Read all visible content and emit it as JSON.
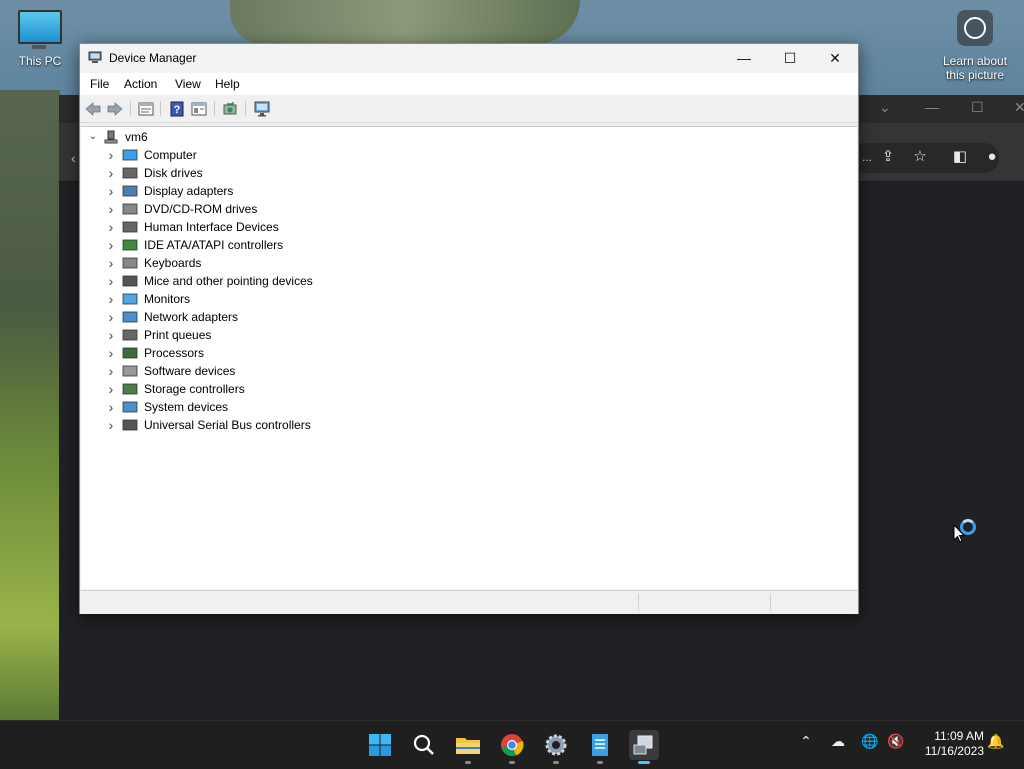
{
  "desktop": {
    "icons": [
      {
        "label": "This PC",
        "icon": "monitor-icon"
      },
      {
        "label": "Learn about\nthis picture",
        "icon": "camera-info-icon"
      }
    ],
    "learn_line1": "Learn about",
    "learn_line2": "this picture"
  },
  "browser": {
    "toolbar_overflow": "..."
  },
  "window": {
    "title": "Device Manager",
    "controls": {
      "minimize": "—",
      "maximize": "☐",
      "close": "✕"
    },
    "menu": [
      "File",
      "Action",
      "View",
      "Help"
    ],
    "toolbar_buttons": [
      "back",
      "forward",
      "properties",
      "help",
      "show-hidden",
      "update-driver",
      "scan-hardware"
    ]
  },
  "tree": {
    "root": "vm6",
    "categories": [
      "Computer",
      "Disk drives",
      "Display adapters",
      "DVD/CD-ROM drives",
      "Human Interface Devices",
      "IDE ATA/ATAPI controllers",
      "Keyboards",
      "Mice and other pointing devices",
      "Monitors",
      "Network adapters",
      "Print queues",
      "Processors",
      "Software devices",
      "Storage controllers",
      "System devices",
      "Universal Serial Bus controllers"
    ]
  },
  "taskbar": {
    "apps": [
      "Start",
      "Search",
      "File Explorer",
      "Google Chrome",
      "Settings",
      "Notepad",
      "Device Manager"
    ],
    "time": "11:09 AM",
    "date": "11/16/2023"
  },
  "colors": {
    "accent": "#4cc2ff",
    "taskbar": "#1f1f1f",
    "window_bg": "#f0f0f0"
  }
}
